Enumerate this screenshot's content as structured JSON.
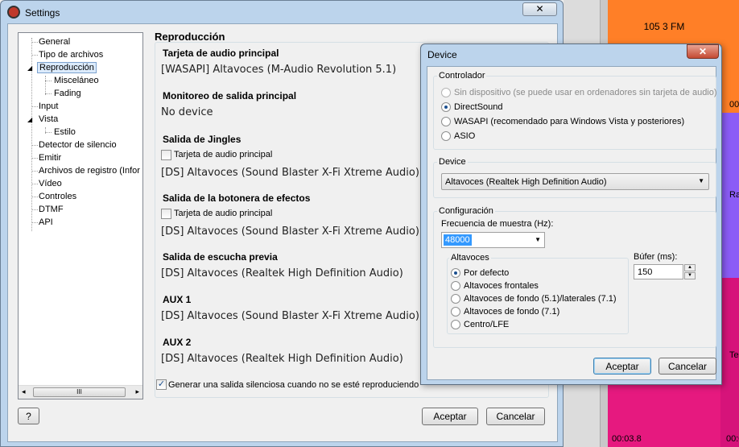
{
  "colors": {
    "orange": "#ff7f27",
    "purple": "#8b5cf6",
    "pink": "#e6197f",
    "magenta": "#d6137a"
  },
  "bg_app": {
    "station": "105 3 FM",
    "time_bottom": "00:03.8",
    "time_right": "00:0",
    "side_r": "Ra",
    "side_b": "00:0",
    "side_t": "Te"
  },
  "settings": {
    "title": "Settings",
    "tree": [
      {
        "label": "General"
      },
      {
        "label": "Tipo de archivos"
      },
      {
        "label": "Reproducción"
      },
      {
        "label": "Misceláneo"
      },
      {
        "label": "Fading"
      },
      {
        "label": "Input"
      },
      {
        "label": "Vista"
      },
      {
        "label": "Estilo"
      },
      {
        "label": "Detector de silencio"
      },
      {
        "label": "Emitir"
      },
      {
        "label": "Archivos de registro (Infor"
      },
      {
        "label": "Vídeo"
      },
      {
        "label": "Controles"
      },
      {
        "label": "DTMF"
      },
      {
        "label": "API"
      }
    ],
    "scroll_thumb": "III",
    "help": "?",
    "section": "Reproducción",
    "groups": [
      {
        "title": "Tarjeta de audio principal",
        "value": "[WASAPI] Altavoces (M-Audio Revolution 5.1)"
      },
      {
        "title": "Monitoreo de salida principal",
        "value": "No device"
      },
      {
        "title": "Salida de Jingles",
        "check": "Tarjeta de audio principal",
        "value": "[DS] Altavoces (Sound Blaster X-Fi Xtreme Audio)"
      },
      {
        "title": "Salida de la botonera de efectos",
        "check": "Tarjeta de audio principal",
        "value": "[DS] Altavoces (Sound Blaster X-Fi Xtreme Audio)"
      },
      {
        "title": "Salida de escucha previa",
        "value": "[DS] Altavoces (Realtek High Definition Audio)"
      },
      {
        "title": "AUX 1",
        "value": "[DS] Altavoces (Sound Blaster X-Fi Xtreme Audio)"
      },
      {
        "title": "AUX 2",
        "value": "[DS] Altavoces (Realtek High Definition Audio)"
      }
    ],
    "silent_check": "Generar una salida silenciosa cuando no se esté reproduciendo na",
    "ok": "Aceptar",
    "cancel": "Cancelar"
  },
  "device": {
    "title": "Device",
    "controller_label": "Controlador",
    "controllers": [
      {
        "label": "Sin dispositivo (se puede usar en ordenadores sin tarjeta de audio)",
        "selected": false,
        "disabled": true
      },
      {
        "label": "DirectSound",
        "selected": true
      },
      {
        "label": "WASAPI (recomendado para Windows Vista y posteriores)",
        "selected": false
      },
      {
        "label": "ASIO",
        "selected": false
      }
    ],
    "device_label": "Device",
    "device_value": "Altavoces (Realtek High Definition Audio)",
    "config_label": "Configuración",
    "freq_label": "Frecuencia de muestra (Hz):",
    "freq_value": "48000",
    "speakers_label": "Altavoces",
    "speakers": [
      {
        "label": "Por defecto",
        "selected": true
      },
      {
        "label": "Altavoces frontales",
        "selected": false
      },
      {
        "label": "Altavoces de fondo (5.1)/laterales (7.1)",
        "selected": false
      },
      {
        "label": "Altavoces de fondo (7.1)",
        "selected": false
      },
      {
        "label": "Centro/LFE",
        "selected": false
      }
    ],
    "buffer_label": "Búfer (ms):",
    "buffer_value": "150",
    "ok": "Aceptar",
    "cancel": "Cancelar"
  }
}
